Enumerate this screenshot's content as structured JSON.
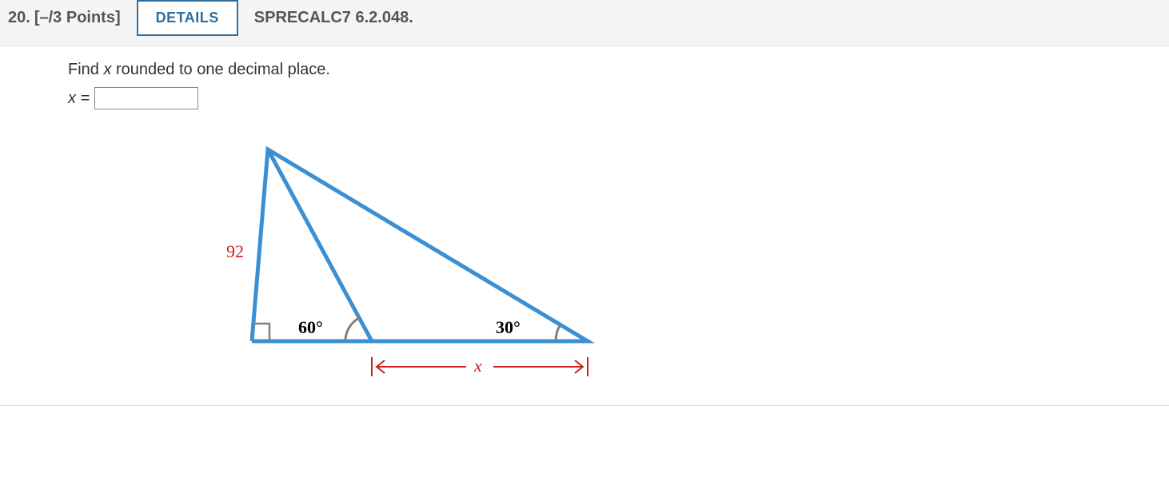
{
  "header": {
    "question_number": "20.",
    "points_label": "[–/3 Points]",
    "details_label": "DETAILS",
    "source": "SPRECALC7 6.2.048."
  },
  "prompt": {
    "text_before_var": "Find ",
    "var": "x",
    "text_after_var": " rounded to one decimal place."
  },
  "answer": {
    "lhs": "x =",
    "value": ""
  },
  "figure": {
    "side_label": "92",
    "angle1": "60°",
    "angle2": "30°",
    "dim_label": "x"
  }
}
